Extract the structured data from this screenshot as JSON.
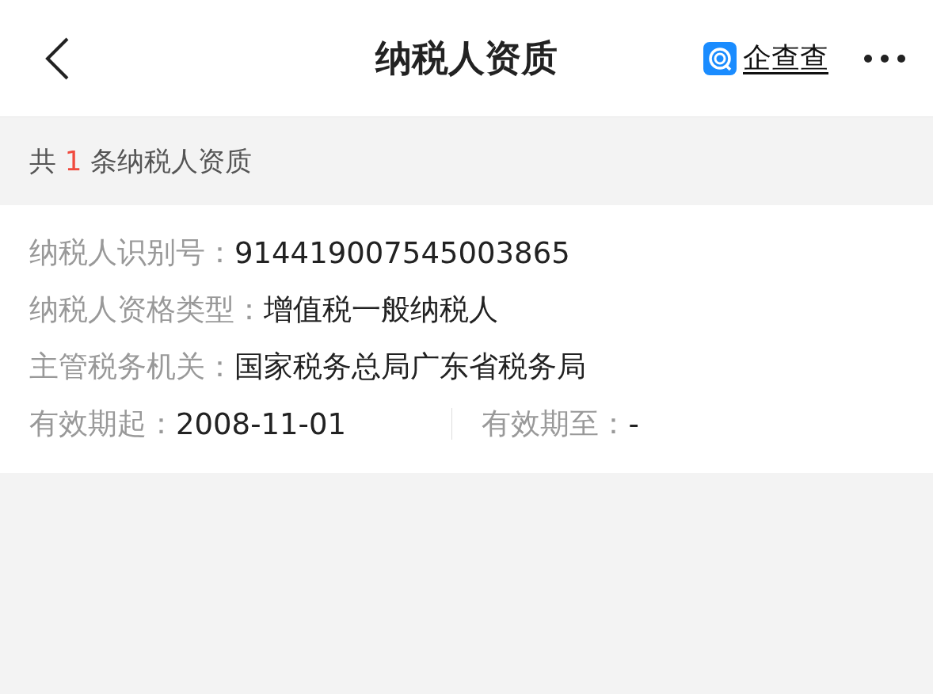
{
  "header": {
    "title": "纳税人资质",
    "brand": "企查查"
  },
  "summary": {
    "prefix": "共",
    "count": "1",
    "suffix": "条纳税人资质"
  },
  "record": {
    "fields": [
      {
        "label": "纳税人识别号：",
        "value": "914419007545003865"
      },
      {
        "label": "纳税人资格类型：",
        "value": "增值税一般纳税人"
      },
      {
        "label": "主管税务机关：",
        "value": "国家税务总局广东省税务局"
      }
    ],
    "dates": [
      {
        "label": "有效期起：",
        "value": "2008-11-01"
      },
      {
        "label": "有效期至：",
        "value": "-"
      }
    ]
  }
}
